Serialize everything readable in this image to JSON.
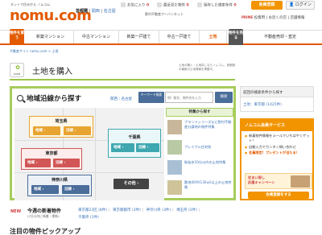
{
  "header": {
    "logo_tagline": "ネットで住みかえ ノムコム",
    "logo": "nomu.com",
    "area_label": "首都圏",
    "area_options": [
      "関西",
      "名古屋"
    ],
    "history": [
      {
        "label": "お気に入り",
        "count": "0"
      },
      {
        "label": "最近見た物件",
        "count": "0"
      },
      {
        "label": "保存した検索条件",
        "count": "0"
      }
    ],
    "register_button": "会員登録",
    "login_button": "ログイン",
    "tagline_prefix": "野村不動産アーバンネット",
    "tagline_prime": "PRIME",
    "mini_nav": [
      "投資用",
      "お近くの店",
      "店舗情報"
    ]
  },
  "main_nav": {
    "buy_label": "物件を買う",
    "items": [
      "新築マンション",
      "中古マンション",
      "新築一戸建て",
      "中古一戸建て",
      "土地"
    ],
    "sell_label": "物件を売る",
    "sell_item": "不動産売却・査定"
  },
  "breadcrumb": "不動産サイト nomu.com > 土地",
  "page": {
    "icon_label": "Land",
    "title": "土地を購入",
    "description": "土地の購入・土地探しならノムコム。首都圏の最新の土地情報を掲載中。"
  },
  "search": {
    "title": "地域沿線から探す",
    "area_links": "関西｜名古屋",
    "keyword_label": "キーワード検索",
    "keyword_placeholder": "例）駅名、物件名を入力",
    "keyword_button": "検索",
    "prefectures": [
      {
        "name": "埼玉県",
        "area": "地域",
        "line": "沿線"
      },
      {
        "name": "千葉県",
        "area": "地域",
        "line": "沿線"
      },
      {
        "name": "東京都",
        "area": "地域",
        "line": "沿線"
      },
      {
        "name": "神奈川県",
        "area": "地域",
        "line": "沿線"
      }
    ],
    "other": "その他"
  },
  "features": {
    "title": "特集から探す",
    "items": [
      "ブランドシリーズなど野村不動産分譲地の物件特集",
      "プレミアム住宅地",
      "駅徒歩10分以内の土地特集",
      "敷地40坪(130㎡)以上の土地特集"
    ]
  },
  "sidebar": {
    "history_title": "前回の検索条件から探す",
    "history_item": "土地：東京都 (1425件)",
    "member_title": "ノムコム会員サービス",
    "member_items": [
      "新着物件情報をメールでいちはやくゲット！",
      "自動入力でカンタン問い合わせ",
      "会員限定！プレゼントが当たる！"
    ],
    "promo_line1": "住まい探し",
    "promo_line2": "応援キャンペーン",
    "member_button": "会員登録をする"
  },
  "new_listings": {
    "badge": "NEW",
    "title": "今週の新着物件",
    "subtitle": "(7日以内に新着・更新)",
    "links": [
      "東京都23区 (8件)",
      "東京都都市 (3件)",
      "神奈川県 (3件)",
      "埼玉県 (2件)",
      "千葉県 (1件)"
    ]
  },
  "pickup_title": "注目の物件ピックアップ"
}
